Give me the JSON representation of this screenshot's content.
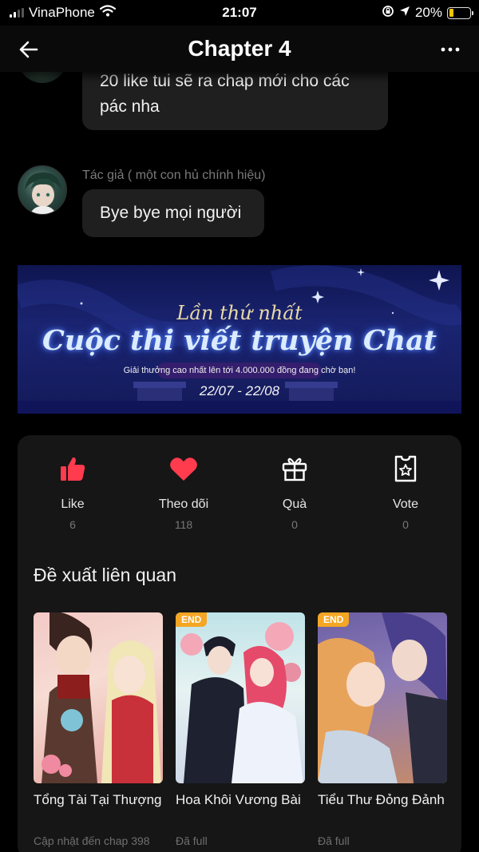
{
  "status_bar": {
    "carrier": "VinaPhone",
    "time": "21:07",
    "battery": "20%",
    "battery_level": 0.2
  },
  "header": {
    "title": "Chapter 4",
    "back_icon": "arrow-left-icon",
    "more_icon": "more-horizontal-icon"
  },
  "chat": {
    "prev_message": "20 like tui sẽ ra chap mới cho các pác nha",
    "author_name": "Tác giả ( một con hủ chính hiệu)",
    "last_message": "Bye bye mọi người"
  },
  "banner": {
    "line1": "Lần thứ nhất",
    "line2": "Cuộc thi viết truyện Chat",
    "line3": "Giải thưởng cao nhất lên tới 4.000.000 đồng đang chờ bạn!",
    "dates": "22/07 - 22/08"
  },
  "actions": [
    {
      "icon": "thumbs-up-icon",
      "label": "Like",
      "count": "6",
      "color": "#ff3b4e"
    },
    {
      "icon": "heart-icon",
      "label": "Theo dõi",
      "count": "118",
      "color": "#ff3b4e"
    },
    {
      "icon": "gift-icon",
      "label": "Quà",
      "count": "0",
      "color": "#ffffff"
    },
    {
      "icon": "vote-ticket-icon",
      "label": "Vote",
      "count": "0",
      "color": "#ffffff"
    }
  ],
  "related": {
    "title": "Đề xuất liên quan",
    "items": [
      {
        "title": "Tổng Tài Tại Thượng",
        "subtitle": "Cập nhật đến chap 398",
        "badge": ""
      },
      {
        "title": "Hoa Khôi Vương Bài",
        "subtitle": "Đã full",
        "badge": "END"
      },
      {
        "title": "Tiểu Thư Đỏng Đảnh",
        "subtitle": "Đã full",
        "badge": "END"
      }
    ]
  },
  "colors": {
    "background": "#000000",
    "bubble": "#1f1f1f",
    "panel": "#161616",
    "accent": "#ff3b4e",
    "end_badge": "#f5a623"
  }
}
